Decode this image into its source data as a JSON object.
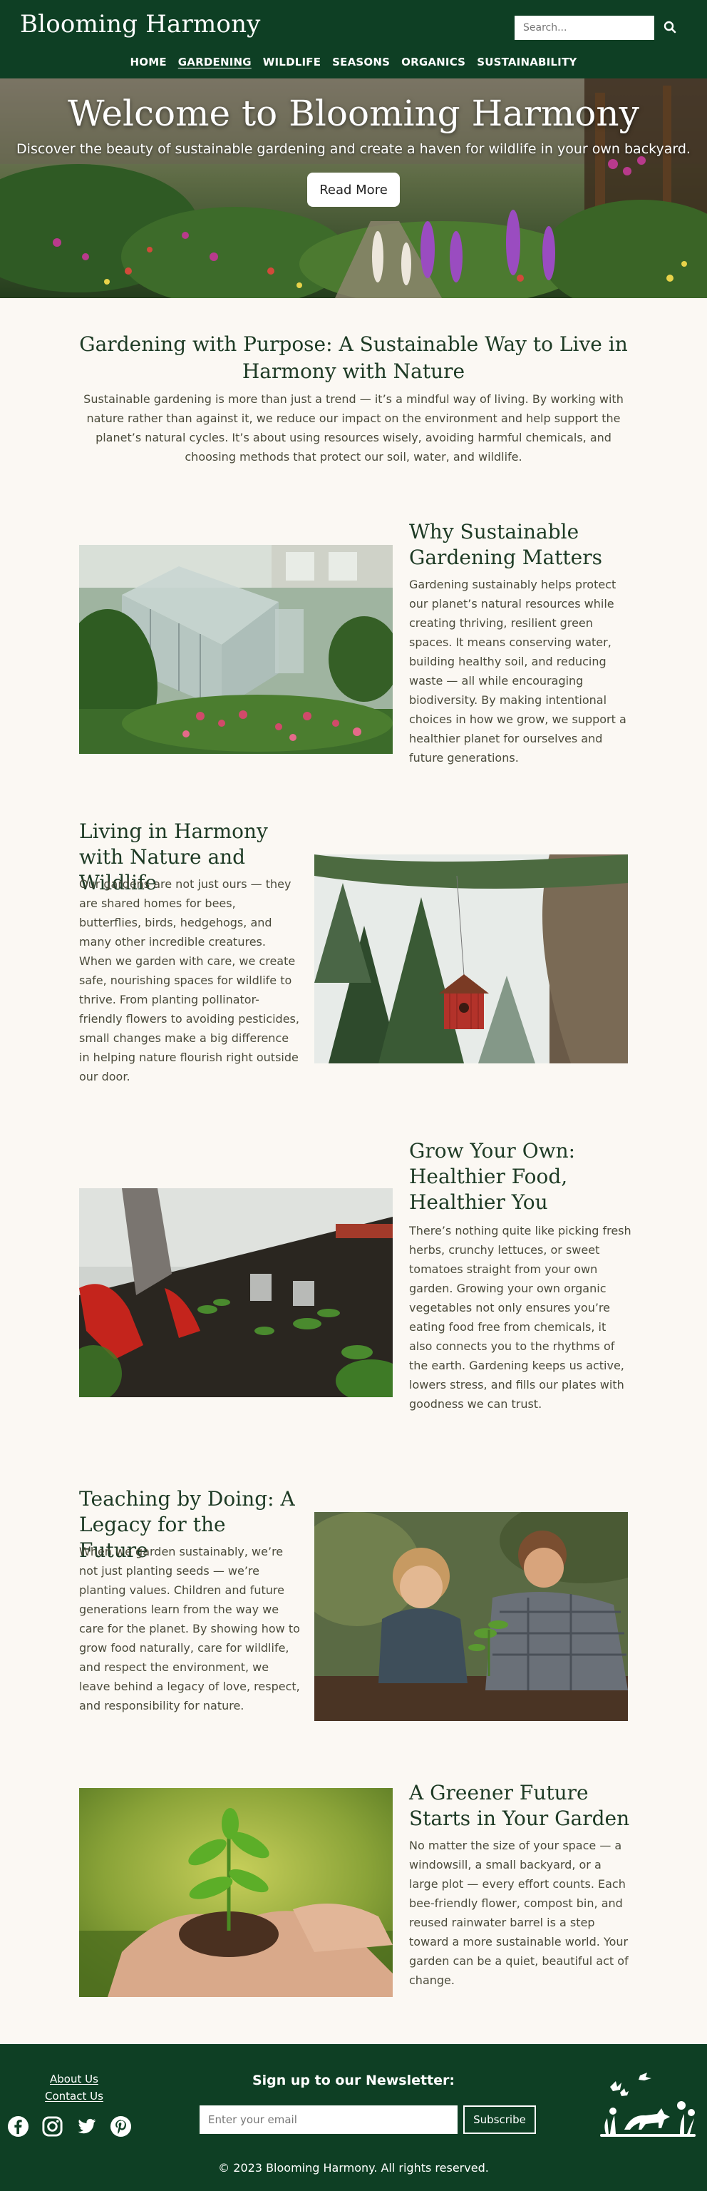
{
  "header": {
    "logo": "Blooming Harmony",
    "search_placeholder": "Search...",
    "nav": [
      "HOME",
      "GARDENING",
      "WILDLIFE",
      "SEASONS",
      "ORGANICS",
      "SUSTAINABILITY"
    ],
    "active_nav": "GARDENING"
  },
  "hero": {
    "title": "Welcome to Blooming Harmony",
    "subtitle": "Discover the beauty of sustainable gardening and create a haven for wildlife in your own backyard.",
    "button": "Read More"
  },
  "intro": {
    "title": "Gardening with Purpose: A Sustainable Way to Live in Harmony with Nature",
    "text": "Sustainable gardening is more than just a trend — it’s a mindful way of living. By working with nature rather than against it, we reduce our impact on the environment and help support the planet’s natural cycles. It’s about using resources wisely, avoiding harmful chemicals, and choosing methods that protect our soil, water, and wildlife."
  },
  "sections": [
    {
      "title": "Why Sustainable Gardening Matters",
      "text": "Gardening sustainably helps protect our planet’s natural resources while creating thriving, resilient green spaces. It means conserving water, building healthy soil, and reducing waste — all while encouraging biodiversity. By making intentional choices in how we grow, we support a healthier planet for ourselves and future generations.",
      "image": "greenhouse-photo"
    },
    {
      "title": "Living in Harmony with Nature and Wildlife",
      "text": "Our gardens are not just ours — they are shared homes for bees, butterflies, birds, hedgehogs, and many other incredible creatures. When we garden with care, we create safe, nourishing spaces for wildlife to thrive. From planting pollinator-friendly flowers to avoiding pesticides, small changes make a big difference in helping nature flourish right outside our door.",
      "image": "birdhouse-photo"
    },
    {
      "title": "Grow Your Own: Healthier Food, Healthier You",
      "text": "There’s nothing quite like picking fresh herbs, crunchy lettuces, or sweet tomatoes straight from your own garden. Growing your own organic vegetables not only ensures you’re eating food free from chemicals, it also connects you to the rhythms of the earth. Gardening keeps us active, lowers stress, and fills our plates with goodness we can trust.",
      "image": "planting-seedlings-photo"
    },
    {
      "title": "Teaching by Doing: A Legacy for the Future",
      "text": "When we garden sustainably, we’re not just planting seeds — we’re planting values. Children and future generations learn from the way we care for the planet. By showing how to grow food naturally, care for wildlife, and respect the environment, we leave behind a legacy of love, respect, and responsibility for nature.",
      "image": "father-and-child-photo"
    },
    {
      "title": "A Greener Future Starts in Your Garden",
      "text": "No matter the size of your space — a windowsill, a small backyard, or a large plot — every effort counts. Each bee-friendly flower, compost bin, and reused rainwater barrel is a step toward a more sustainable world. Your garden can be a quiet, beautiful act of change.",
      "image": "hands-holding-seedling-photo"
    }
  ],
  "footer": {
    "links": [
      "About Us",
      "Contact Us"
    ],
    "socials": [
      "facebook-icon",
      "instagram-icon",
      "twitter-icon",
      "pinterest-icon"
    ],
    "newsletter_title": "Sign up to our Newsletter:",
    "email_placeholder": "Enter your email",
    "subscribe": "Subscribe",
    "copyright": "© 2023 Blooming Harmony. All rights reserved."
  },
  "colors": {
    "header_bg": "#0e3f24",
    "page_bg": "#fbf8f3",
    "heading": "#1d3a24",
    "body_text": "#4a4a3a"
  }
}
